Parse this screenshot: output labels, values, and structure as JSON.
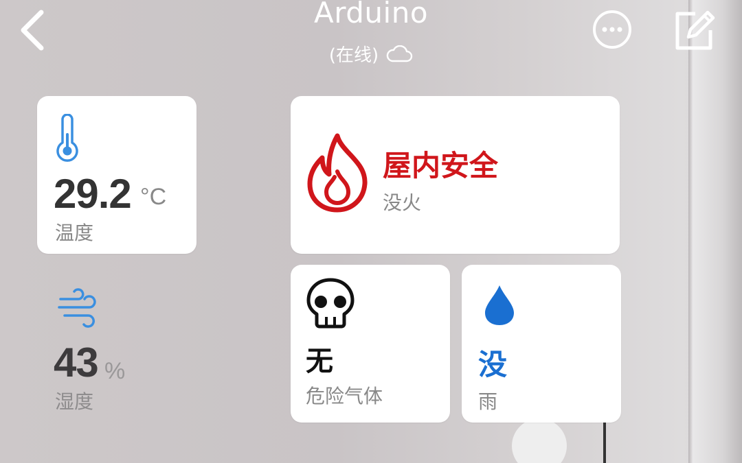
{
  "header": {
    "title": "Arduino",
    "status": "(在线)",
    "status_icon": "cloud-icon",
    "back_icon": "chevron-left-icon",
    "more_icon": "more-icon",
    "edit_icon": "edit-icon"
  },
  "temperature": {
    "value": "29.2",
    "unit": "°C",
    "label": "温度",
    "icon": "thermometer-icon",
    "icon_color": "#3a8fe0"
  },
  "humidity": {
    "value": "43",
    "unit": "%",
    "label": "湿度",
    "icon": "wind-icon",
    "icon_color": "#3a8fe0"
  },
  "fire": {
    "title": "屋内安全",
    "status": "没火",
    "icon": "flame-icon",
    "color": "#d0161b"
  },
  "gas": {
    "value": "无",
    "label": "危险气体",
    "icon": "skull-icon"
  },
  "rain": {
    "value": "没",
    "label": "雨",
    "icon": "water-drop-icon",
    "color": "#1a6fd1"
  }
}
